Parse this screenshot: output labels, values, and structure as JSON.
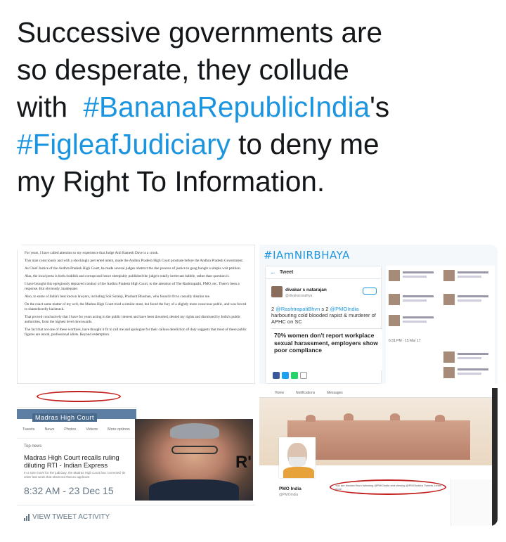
{
  "tweet": {
    "line1": "Successive governments are",
    "line2": "so desperate, they collude",
    "line3_pre": "with  ",
    "hashtag1": "#BananaRepublicIndia",
    "line3_post": "'s",
    "hashtag2": "#FigleafJudiciary",
    "line4_post": " to deny me",
    "line5": "my Right To Information."
  },
  "colors": {
    "link": "#1b95e0",
    "text": "#14171a",
    "muted": "#657786",
    "highlight_oval": "#c31d1d"
  },
  "image1": {
    "paragraphs": [
      "For years, I have called attention to my experience that Judge Anil Ramesh Dave is a crook.",
      "This man consciously and with a shockingly perverted intent, made the Andhra Pradesh High Court prostrate before the Andhra Pradesh Government.",
      "As Chief Justice of the Andhra Pradesh High Court, he made several judges obstruct the due process of justice to gang bungle a simple writ petition.",
      "Alas, the local press is both cloddish and corrupt and hence sheepishly published the judge's totally irrelevant babble, rather than question it.",
      "I have brought this egregiously depraved conduct of the Andhra Pradesh High Court, to the attention of The Rashtrapathi, PMO, etc. There's been a response. But obviously, inadequate.",
      "Also, to some of India's best known lawyers, including Soli Sorabji, Prashant Bhushan, who found it fit to casually dismiss me.",
      "On the exact same matter of my writ, the Madras High Court tried a similar stunt, but faced the fury of a slightly more conscious public, and was forced to shamefacedly backtrack.",
      "That proved conclusively that I have for years acting in the public interest and have been thwarted, denied my rights and dismissed by India's public authorities, from the highest level downwards.",
      "The fact that not one of these worthies, have thought it fit to call me and apologise for their callous dereliction of duty suggests that most of these public figures are moral, professional idiots. Beyond redemption."
    ]
  },
  "image2": {
    "hashtag_header": "#IAmNIRBHAYA",
    "card_title": "Tweet",
    "user_name": "divakar s natarajan",
    "user_handle": "@divakarssathya",
    "body_prefix": "2 ",
    "mention1": "@RashtrapatiBhvn",
    "body_mid": " s 2 ",
    "mention2": "@PMOIndia",
    "body_rest": " harbouring cold blooded rapist & murderer of APHC on SC",
    "quote": "70% women don't report workplace sexual harassment, employers show poor compliance",
    "time": "6:31 PM - 15 Mar 17"
  },
  "image3": {
    "profile_name": "Madras High Court",
    "tabs": [
      "Tweets",
      "News",
      "Photos",
      "Videos",
      "More options"
    ],
    "top_news": "Top news",
    "headline": "Madras High Court recalls ruling diluting RTI - Indian Express",
    "snippet": "In a rare move for the judiciary, the Madras High Court has 'corrected' its order last week that observed that an applicant",
    "timestamp": "8:32 AM - 23 Dec 15",
    "activity": "VIEW TWEET ACTIVITY",
    "photo_letter": "R'"
  },
  "image4": {
    "nav": [
      "Home",
      "Notifications",
      "Messages"
    ],
    "profile_name": "PMO India",
    "profile_handle": "@PMOIndia",
    "follow_note": "You are blocked from following @PMOIndia and viewing @PMOIndia's Tweets. Learn more"
  }
}
